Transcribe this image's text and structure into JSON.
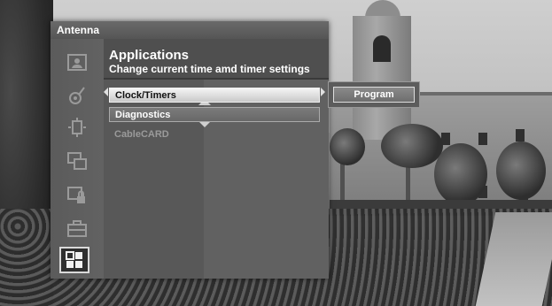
{
  "panel": {
    "source": "Antenna",
    "title": "Applications",
    "subtitle": "Change current time amd timer settings"
  },
  "sidebar": {
    "items": [
      {
        "icon": "picture-icon"
      },
      {
        "icon": "sound-icon"
      },
      {
        "icon": "channel-icon"
      },
      {
        "icon": "picture-in-picture-icon"
      },
      {
        "icon": "lock-icon"
      },
      {
        "icon": "setup-toolbox-icon"
      },
      {
        "icon": "applications-grid-icon",
        "active": true
      }
    ]
  },
  "menu": {
    "items": [
      {
        "label": "Clock/Timers",
        "state": "selected"
      },
      {
        "label": "Diagnostics",
        "state": "normal"
      },
      {
        "label": "CableCARD",
        "state": "disabled"
      }
    ]
  },
  "submenu": {
    "items": [
      {
        "label": "Program"
      }
    ]
  }
}
